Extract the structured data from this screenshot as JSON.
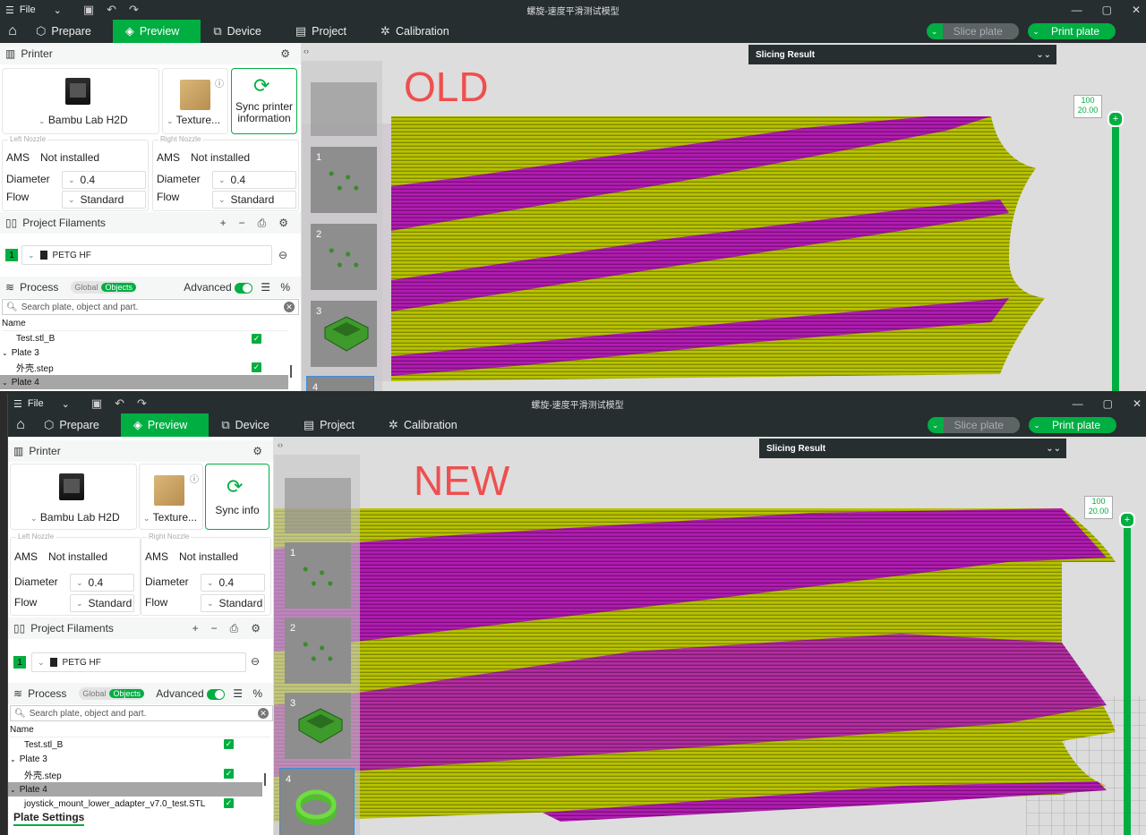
{
  "old": {
    "window_title": "螺旋-速度平滑测试模型",
    "menu_file": "File",
    "tabs": [
      "Prepare",
      "Preview",
      "Device",
      "Project",
      "Calibration"
    ],
    "active_tab": "Preview",
    "slice_plate": "Slice plate",
    "print_plate": "Print plate",
    "printer_section": "Printer",
    "printer_name": "Bambu Lab H2D",
    "plate_type": "Texture...",
    "sync_label": "Sync printer information",
    "left_nozzle": "Left Nozzle",
    "right_nozzle": "Right Nozzle",
    "ams_label": "AMS",
    "ams_value": "Not installed",
    "diameter_label": "Diameter",
    "diameter_value": "0.4",
    "flow_label": "Flow",
    "flow_value": "Standard",
    "filaments_section": "Project Filaments",
    "filament_index": "1",
    "filament_name": "PETG HF",
    "process_section": "Process",
    "toggle_global": "Global",
    "toggle_objects": "Objects",
    "advanced_label": "Advanced",
    "search_placeholder": "Search plate, object and part.",
    "tree_header": "Name",
    "tree_items": [
      "Test.stl_B",
      "Plate 3",
      "外壳.step",
      "Plate 4"
    ],
    "slicing_result": "Slicing Result",
    "big_label": "OLD",
    "layer_top": "100",
    "layer_height": "20.00",
    "plate_numbers": [
      "1",
      "2",
      "3",
      "4"
    ]
  },
  "new": {
    "window_title": "螺旋-速度平滑测试模型",
    "menu_file": "File",
    "tabs": [
      "Prepare",
      "Preview",
      "Device",
      "Project",
      "Calibration"
    ],
    "active_tab": "Preview",
    "slice_plate": "Slice plate",
    "print_plate": "Print plate",
    "printer_section": "Printer",
    "printer_name": "Bambu Lab H2D",
    "plate_type": "Texture...",
    "sync_label": "Sync info",
    "left_nozzle": "Left Nozzle",
    "right_nozzle": "Right Nozzle",
    "ams_label": "AMS",
    "ams_value": "Not installed",
    "diameter_label": "Diameter",
    "diameter_value": "0.4",
    "flow_label": "Flow",
    "flow_value": "Standard",
    "filaments_section": "Project Filaments",
    "filament_index": "1",
    "filament_name": "PETG HF",
    "process_section": "Process",
    "toggle_global": "Global",
    "toggle_objects": "Objects",
    "advanced_label": "Advanced",
    "search_placeholder": "Search plate, object and part.",
    "tree_header": "Name",
    "tree_items": [
      "Test.stl_B",
      "Plate 3",
      "外壳.step",
      "Plate 4",
      "joystick_mount_lower_adapter_v7.0_test.STL"
    ],
    "plate_settings": "Plate Settings",
    "slicing_result": "Slicing Result",
    "big_label": "NEW",
    "layer_top": "100",
    "layer_height": "20.00",
    "plate_numbers": [
      "1",
      "2",
      "3",
      "4"
    ]
  },
  "colors": {
    "accent": "#00ae42",
    "chrome": "#262e30",
    "filament_yellow": "#b8c200",
    "filament_purple": "#b41fb4",
    "label_red": "#ef4f4f"
  },
  "icons": [
    "menu-icon",
    "save-icon",
    "undo-icon",
    "redo-icon",
    "home-icon",
    "cube-icon",
    "device-icon",
    "project-icon",
    "calibration-icon",
    "gear-icon",
    "sync-icon",
    "plus-icon",
    "minus-icon",
    "list-icon",
    "close-icon"
  ]
}
